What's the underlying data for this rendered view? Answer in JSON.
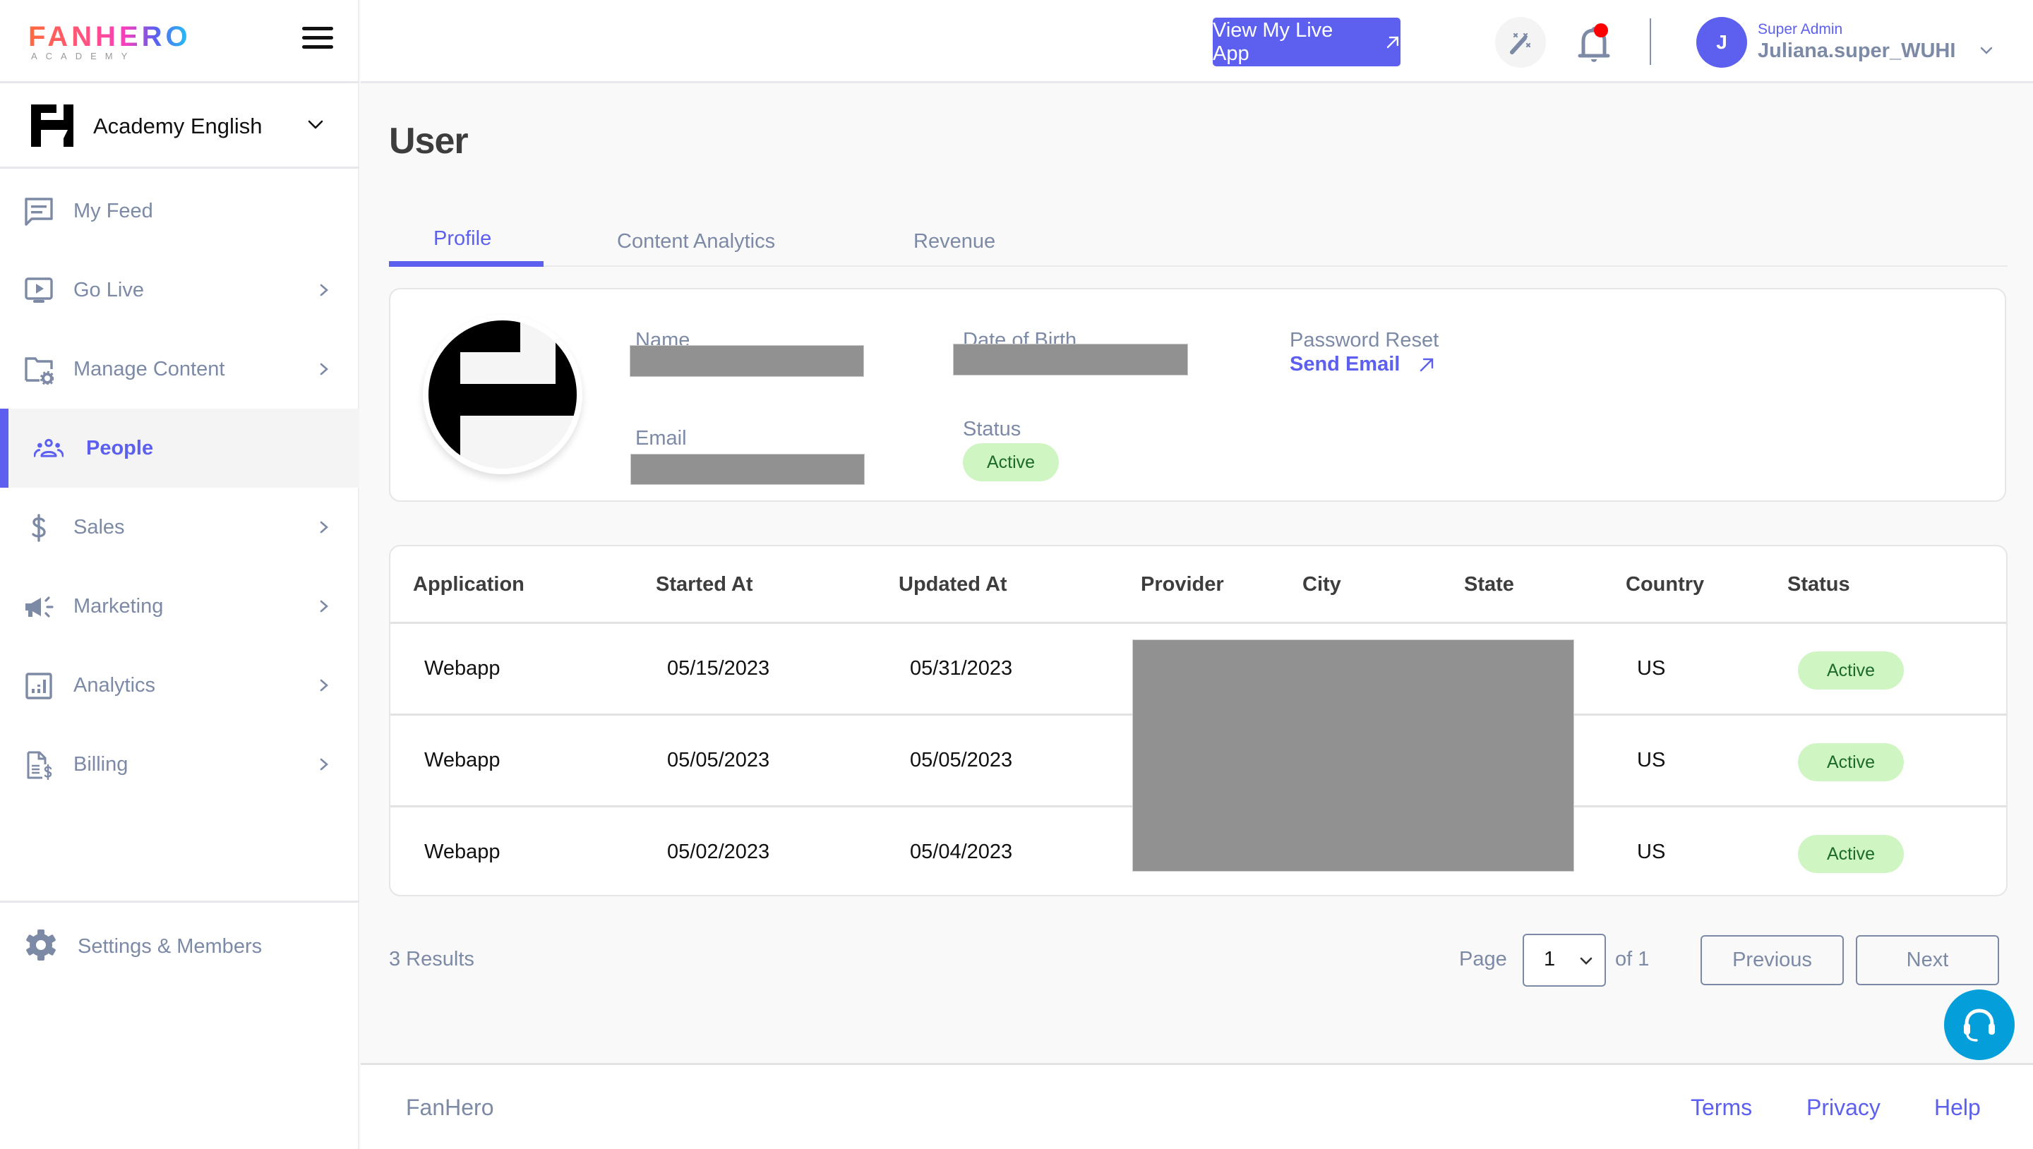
{
  "brand": {
    "logo_text": "FANHERO",
    "logo_subtext": "ACADEMY"
  },
  "org_switcher": {
    "name": "Academy English"
  },
  "sidebar": {
    "items": [
      {
        "label": "My Feed",
        "icon": "feed-icon",
        "has_chevron": false,
        "active": false
      },
      {
        "label": "Go Live",
        "icon": "go-live-icon",
        "has_chevron": true,
        "active": false
      },
      {
        "label": "Manage Content",
        "icon": "folder-gear-icon",
        "has_chevron": true,
        "active": false
      },
      {
        "label": "People",
        "icon": "people-icon",
        "has_chevron": false,
        "active": true
      },
      {
        "label": "Sales",
        "icon": "dollar-icon",
        "has_chevron": true,
        "active": false
      },
      {
        "label": "Marketing",
        "icon": "megaphone-icon",
        "has_chevron": true,
        "active": false
      },
      {
        "label": "Analytics",
        "icon": "bar-chart-icon",
        "has_chevron": true,
        "active": false
      },
      {
        "label": "Billing",
        "icon": "invoice-icon",
        "has_chevron": true,
        "active": false
      }
    ],
    "settings_label": "Settings & Members"
  },
  "header": {
    "live_app_button": "View My Live App",
    "notifications_unread": true,
    "user": {
      "avatar_initial": "J",
      "role": "Super Admin",
      "username": "Juliana.super_WUHI"
    }
  },
  "page": {
    "title": "User",
    "tabs": [
      {
        "label": "Profile",
        "active": true
      },
      {
        "label": "Content Analytics",
        "active": false
      },
      {
        "label": "Revenue",
        "active": false
      }
    ]
  },
  "profile": {
    "name_label": "Name",
    "name_value_redacted": true,
    "dob_label": "Date of Birth",
    "dob_value_redacted": true,
    "email_label": "Email",
    "email_value_redacted": true,
    "status_label": "Status",
    "status_value": "Active",
    "password_reset_label": "Password Reset",
    "send_email_label": "Send Email"
  },
  "sessions_table": {
    "columns": [
      "Application",
      "Started At",
      "Updated At",
      "Provider",
      "City",
      "State",
      "Country",
      "Status"
    ],
    "rows": [
      {
        "application": "Webapp",
        "started_at": "05/15/2023",
        "updated_at": "05/31/2023",
        "provider": "[redacted]",
        "city": "[redacted]",
        "state": "[redacted]",
        "country": "US",
        "status": "Active"
      },
      {
        "application": "Webapp",
        "started_at": "05/05/2023",
        "updated_at": "05/05/2023",
        "provider": "[redacted]",
        "city": "[redacted]",
        "state": "[redacted]",
        "country": "US",
        "status": "Active"
      },
      {
        "application": "Webapp",
        "started_at": "05/02/2023",
        "updated_at": "05/04/2023",
        "provider": "[redacted]",
        "city": "[redacted]",
        "state": "[redacted]",
        "country": "US",
        "status": "Active"
      }
    ]
  },
  "pagination": {
    "results_text": "3 Results",
    "page_label": "Page",
    "current_page": "1",
    "of_text": "of 1",
    "previous_label": "Previous",
    "next_label": "Next"
  },
  "footer": {
    "brand": "FanHero",
    "links": [
      "Terms",
      "Privacy",
      "Help"
    ]
  },
  "colors": {
    "accent": "#5d60ef",
    "muted_text": "#7c8aa6",
    "active_badge_bg": "#cff5c2",
    "active_badge_text": "#1d6a2d",
    "notification_dot": "#ff0000",
    "support_button": "#049edb"
  }
}
